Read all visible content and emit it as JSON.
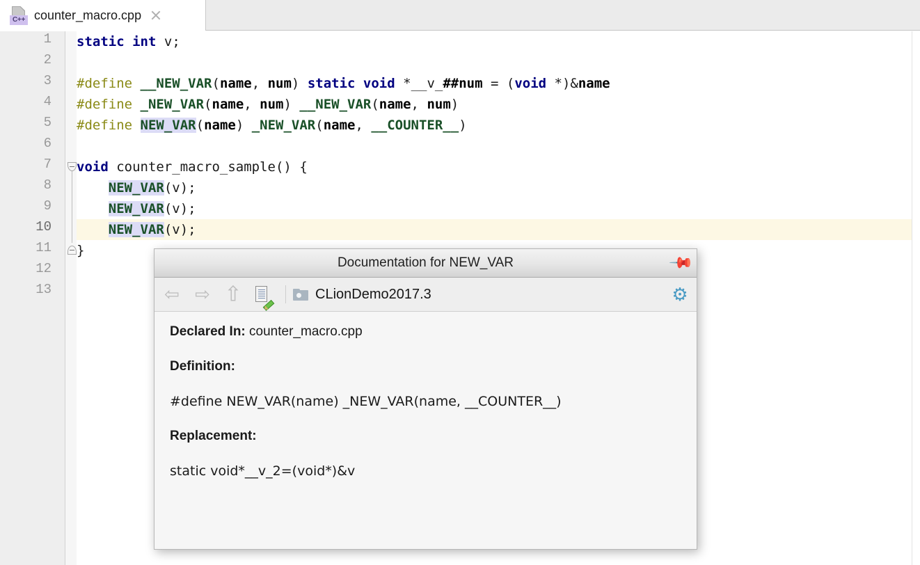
{
  "window": {
    "app": "CLion",
    "tab": {
      "filename": "counter_macro.cpp",
      "file_type_badge": "C++",
      "file_icon": "cpp-file-icon",
      "close_icon": "close-icon"
    }
  },
  "editor": {
    "line_numbers": [
      "1",
      "2",
      "3",
      "4",
      "5",
      "6",
      "7",
      "8",
      "9",
      "10",
      "11",
      "12",
      "13"
    ],
    "current_line": 10,
    "fold_markers": [
      {
        "line": 7,
        "state": "expanded",
        "icon": "fold-expanded-icon"
      },
      {
        "line": 11,
        "state": "end",
        "icon": "fold-end-icon"
      }
    ],
    "lines": [
      {
        "n": 1,
        "text": "static int v;"
      },
      {
        "n": 2,
        "text": ""
      },
      {
        "n": 3,
        "text": "#define __NEW_VAR(name, num) static void *__v_##num = (void *)&name"
      },
      {
        "n": 4,
        "text": "#define _NEW_VAR(name, num) __NEW_VAR(name, num)"
      },
      {
        "n": 5,
        "text": "#define NEW_VAR(name) _NEW_VAR(name, __COUNTER__)"
      },
      {
        "n": 6,
        "text": ""
      },
      {
        "n": 7,
        "text": "void counter_macro_sample() {"
      },
      {
        "n": 8,
        "text": "    NEW_VAR(v);"
      },
      {
        "n": 9,
        "text": "    NEW_VAR(v);"
      },
      {
        "n": 10,
        "text": "    NEW_VAR(v);"
      },
      {
        "n": 11,
        "text": "}"
      },
      {
        "n": 12,
        "text": ""
      },
      {
        "n": 13,
        "text": ""
      }
    ],
    "colors": {
      "keyword": "#000080",
      "preprocessor": "#8a8a16",
      "macro_name": "#1a5028",
      "plain": "#1a1a1a",
      "usage_highlight": "#dcdcf6",
      "current_line_highlight": "#fdf8e4",
      "gutter_bg": "#eeeeee",
      "editor_bg": "#ffffff"
    }
  },
  "doc_popup": {
    "title": "Documentation for NEW_VAR",
    "pin_icon": "pin-icon",
    "toolbar": {
      "back_icon": "arrow-left-icon",
      "back_label": "⇦",
      "forward_icon": "arrow-right-icon",
      "forward_label": "⇨",
      "up_icon": "arrow-up-icon",
      "up_label": "⇧",
      "edit_source_icon": "edit-source-icon",
      "module_icon": "folder-icon",
      "module_name": "CLionDemo2017.3",
      "settings_icon": "gear-icon",
      "settings_glyph": "⚙"
    },
    "content": {
      "declared_in_label": "Declared In:",
      "declared_in_value": "counter_macro.cpp",
      "definition_label": "Definition:",
      "definition_code": "#define NEW_VAR(name) _NEW_VAR(name, __COUNTER__)",
      "replacement_label": "Replacement:",
      "replacement_code": "static void*__v_2=(void*)&v"
    },
    "colors": {
      "title_bar": "#e6e6e6",
      "toolbar_bg": "#eeeeee",
      "body_bg": "#f6f6f6",
      "gear_accent": "#4a9bc4"
    }
  }
}
